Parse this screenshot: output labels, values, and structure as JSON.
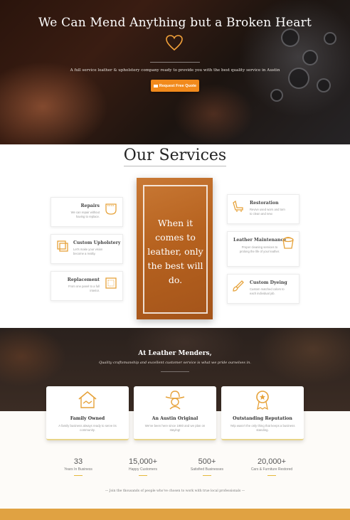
{
  "hero": {
    "title": "We Can Mend Anything but a Broken Heart",
    "subtitle": "A full service leather & upholstery company ready to provide you with the best quality service in Austin",
    "cta_label": "Request Free Quote"
  },
  "services": {
    "title": "Our Services",
    "feature_text": "When it comes to leather, only the best will do.",
    "items": [
      {
        "title": "Repairs",
        "desc": "We can repair without having to replace.",
        "icon": "pocket-icon"
      },
      {
        "title": "Custom Upholstery",
        "desc": "Let's make your vision become a reality.",
        "icon": "fabric-swatch-icon"
      },
      {
        "title": "Replacement",
        "desc": "From one panel to a full interior.",
        "icon": "panel-icon"
      },
      {
        "title": "Restoration",
        "desc": "Revive used worn and torn to clean and new.",
        "icon": "car-seat-icon"
      },
      {
        "title": "Leather Maintenance",
        "desc": "Proper cleaning services to prolong the life of your leather.",
        "icon": "bucket-icon"
      },
      {
        "title": "Custom Dyeing",
        "desc": "Custom matched colors to each individual job.",
        "icon": "paint-brush-icon"
      }
    ]
  },
  "about": {
    "title": "At Leather Menders,",
    "subtitle": "Quality craftsmanship and excellent customer service is what we pride ourselves in.",
    "cards": [
      {
        "title": "Family Owned",
        "desc": "A family business always ready to serve its community.",
        "icon": "house-handshake-icon"
      },
      {
        "title": "An Austin Original",
        "desc": "We've been here since 1980 and we plan on staying!",
        "icon": "cowboy-icon"
      },
      {
        "title": "Outstanding Reputation",
        "desc": "Yelp wasn't the only thing that keeps a business standing.",
        "icon": "award-medal-icon"
      }
    ]
  },
  "stats": [
    {
      "value": "33",
      "label": "Years In Business"
    },
    {
      "value": "15,000+",
      "label": "Happy Customers"
    },
    {
      "value": "500+",
      "label": "Satisfied Businesses"
    },
    {
      "value": "20,000+",
      "label": "Cars & Furniture Restored"
    }
  ],
  "join_text": "— Join the thousands of people who've chosen to work with true local professionals —",
  "colors": {
    "accent": "#f18a1c",
    "gold": "#e5b93a",
    "feature": "#b6621f"
  }
}
